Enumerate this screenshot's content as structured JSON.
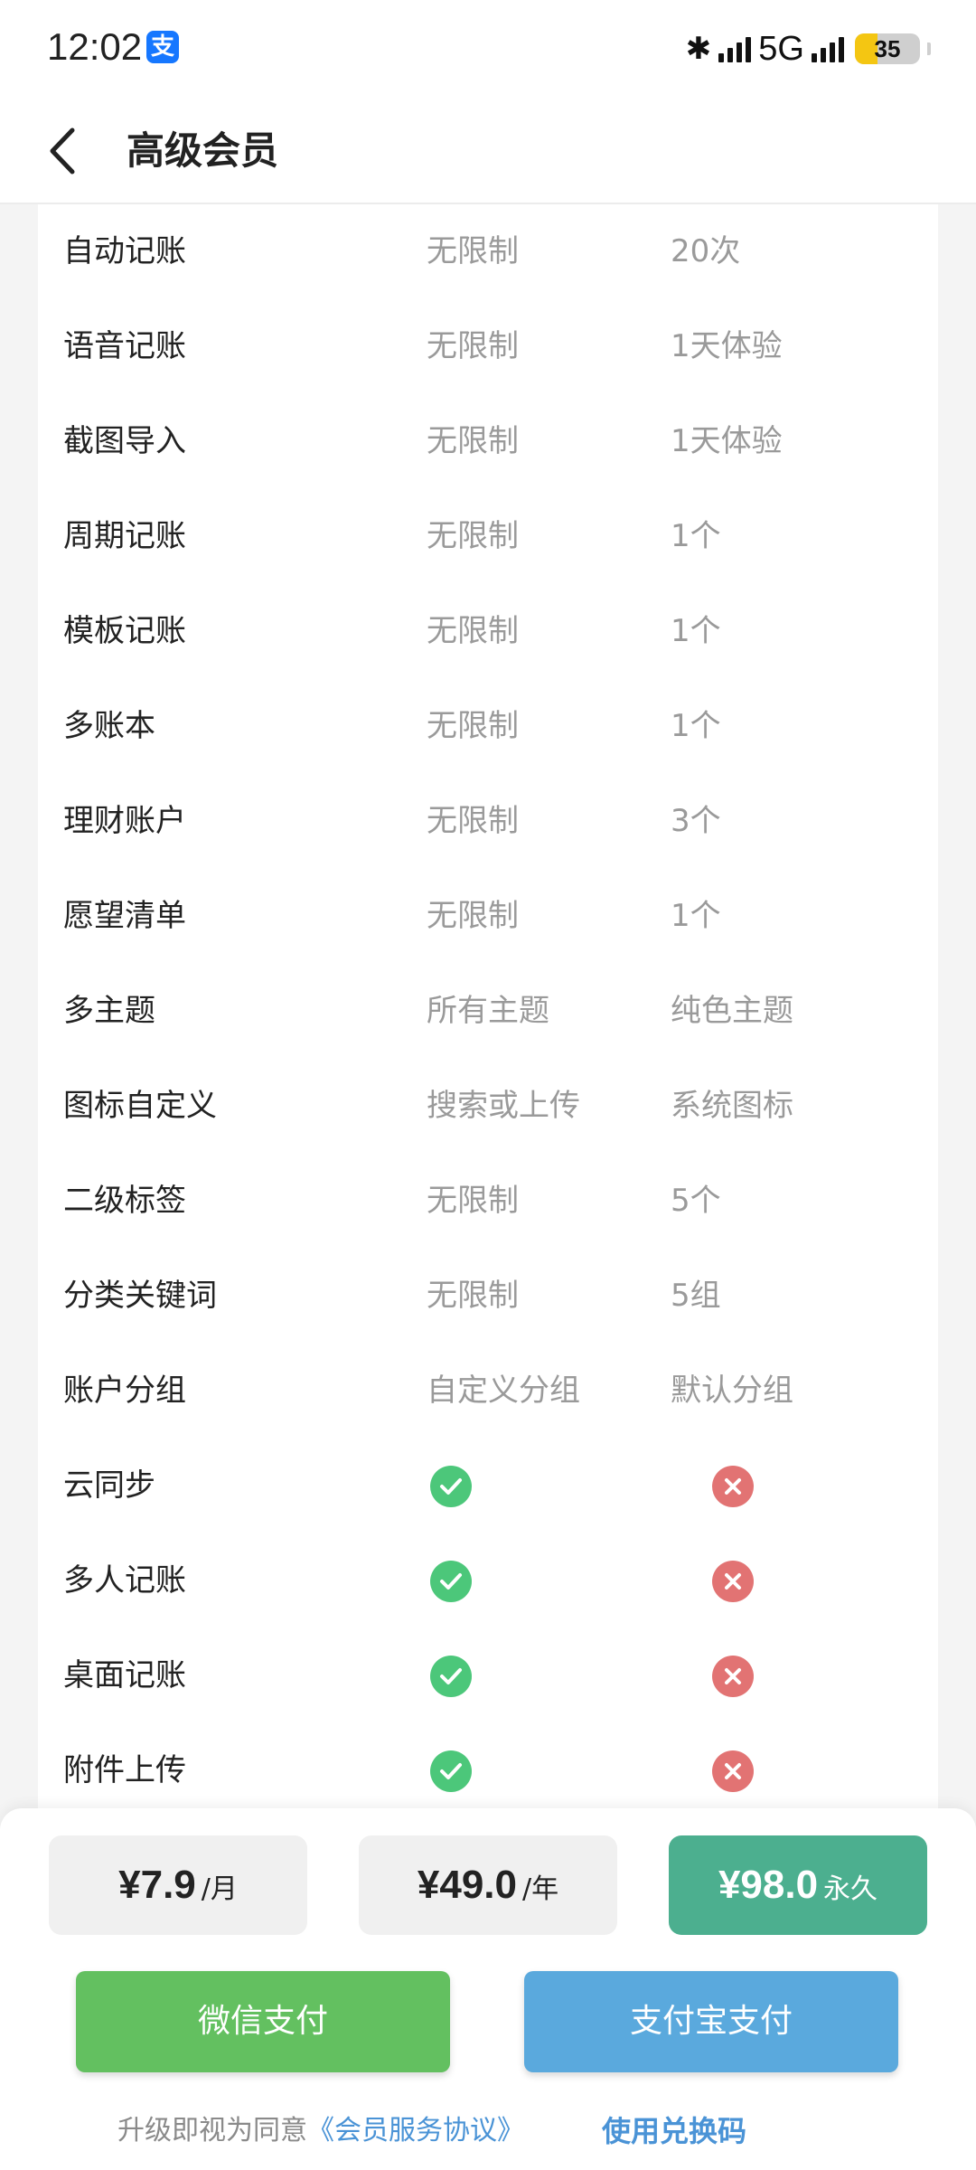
{
  "status_bar": {
    "time": "12:02",
    "app_badge": "支",
    "network": "5G",
    "battery": "35",
    "battery_level": 0.35
  },
  "header": {
    "title": "高级会员",
    "back_icon": "chevron-left-icon"
  },
  "features": [
    {
      "name": "自动记账",
      "vip": "无限制",
      "free": "20次"
    },
    {
      "name": "语音记账",
      "vip": "无限制",
      "free": "1天体验"
    },
    {
      "name": "截图导入",
      "vip": "无限制",
      "free": "1天体验"
    },
    {
      "name": "周期记账",
      "vip": "无限制",
      "free": "1个"
    },
    {
      "name": "模板记账",
      "vip": "无限制",
      "free": "1个"
    },
    {
      "name": "多账本",
      "vip": "无限制",
      "free": "1个"
    },
    {
      "name": "理财账户",
      "vip": "无限制",
      "free": "3个"
    },
    {
      "name": "愿望清单",
      "vip": "无限制",
      "free": "1个"
    },
    {
      "name": "多主题",
      "vip": "所有主题",
      "free": "纯色主题"
    },
    {
      "name": "图标自定义",
      "vip": "搜索或上传",
      "free": "系统图标"
    },
    {
      "name": "二级标签",
      "vip": "无限制",
      "free": "5个"
    },
    {
      "name": "分类关键词",
      "vip": "无限制",
      "free": "5组"
    },
    {
      "name": "账户分组",
      "vip": "自定义分组",
      "free": "默认分组"
    },
    {
      "name": "云同步",
      "vip_icon": "check-icon",
      "free_icon": "cross-icon"
    },
    {
      "name": "多人记账",
      "vip_icon": "check-icon",
      "free_icon": "cross-icon"
    },
    {
      "name": "桌面记账",
      "vip_icon": "check-icon",
      "free_icon": "cross-icon"
    },
    {
      "name": "附件上传",
      "vip_icon": "check-icon",
      "free_icon": "cross-icon"
    }
  ],
  "plans": [
    {
      "price": "¥7.9",
      "unit": "/月"
    },
    {
      "price": "¥49.0",
      "unit": "/年"
    },
    {
      "price": "¥98.0",
      "unit": "永久",
      "selected": true
    }
  ],
  "payment": {
    "wechat": "微信支付",
    "alipay": "支付宝支付"
  },
  "footer": {
    "agree_prefix": "升级即视为同意",
    "agreement_link": "《会员服务协议》",
    "redeem": "使用兑换码"
  },
  "colors": {
    "selected_plan": "#4caf8f",
    "wechat": "#63c060",
    "alipay": "#5aa9dd",
    "check": "#4cc77a",
    "cross": "#e27373",
    "link": "#4a93d6"
  }
}
